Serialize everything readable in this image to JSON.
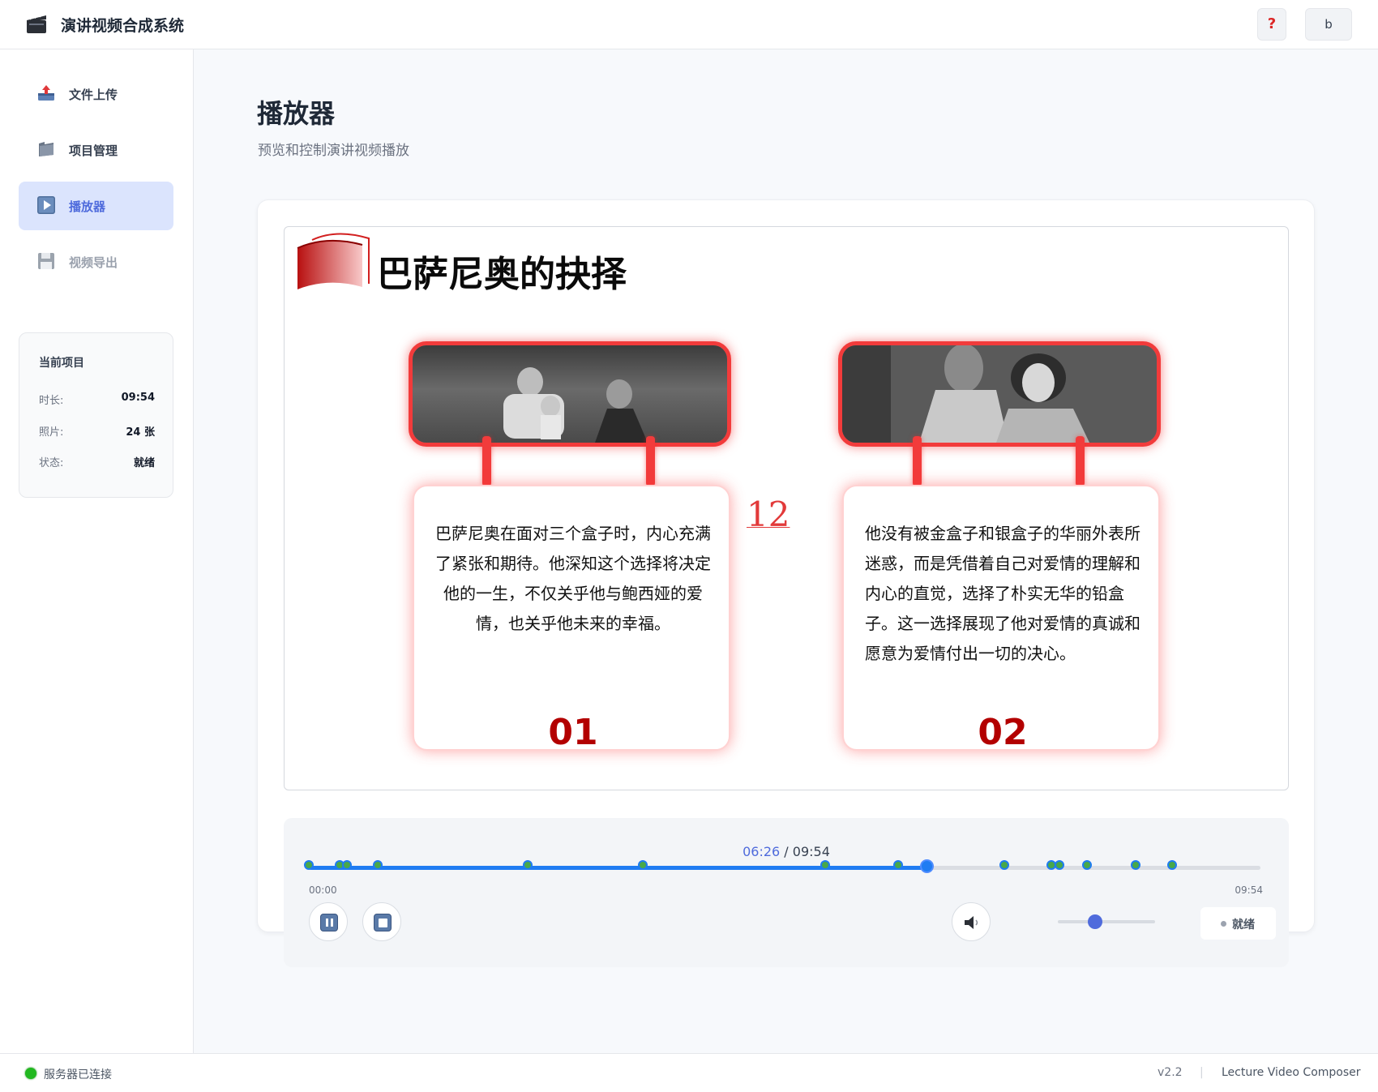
{
  "app": {
    "title": "演讲视频合成系统",
    "help_label": "?",
    "user_label": "b"
  },
  "sidebar": {
    "items": [
      {
        "label": "文件上传",
        "icon": "upload-tray-icon",
        "state": "normal"
      },
      {
        "label": "项目管理",
        "icon": "folder-icon",
        "state": "normal"
      },
      {
        "label": "播放器",
        "icon": "play-icon",
        "state": "active"
      },
      {
        "label": "视频导出",
        "icon": "floppy-disk-icon",
        "state": "disabled"
      }
    ],
    "project": {
      "title": "当前项目",
      "duration_label": "时长:",
      "duration_value": "09:54",
      "photos_label": "照片:",
      "photos_value": "24 张",
      "status_label": "状态:",
      "status_value": "就绪"
    }
  },
  "main": {
    "title": "播放器",
    "subtitle": "预览和控制演讲视频播放"
  },
  "slide": {
    "title": "巴萨尼奥的抉择",
    "page_number": "12",
    "cards": [
      {
        "text": "巴萨尼奥在面对三个盒子时，内心充满了紧张和期待。他深知这个选择将决定他的一生，不仅关乎他与鲍西娅的爱情，也关乎他未来的幸福。",
        "number": "01"
      },
      {
        "text": "他没有被金盒子和银盒子的华丽外表所迷惑，而是凭借着自己对爱情的理解和内心的直觉，选择了朴实无华的铅盒子。这一选择展现了他对爱情的真诚和愿意为爱情付出一切的决心。",
        "number": "02"
      }
    ]
  },
  "player": {
    "current_time": "06:26",
    "separator": "/",
    "total_time": "09:54",
    "start_tick": "00:00",
    "end_tick": "09:54",
    "progress_fraction": 0.649,
    "markers_fraction": [
      0.0,
      0.032,
      0.04,
      0.072,
      0.23,
      0.351,
      0.543,
      0.619,
      0.731,
      0.78,
      0.789,
      0.818,
      0.869,
      0.907
    ],
    "volume_fraction": 0.38,
    "status": "就绪",
    "colors": {
      "accent": "#1f7cf2",
      "marker": "#48a84a",
      "brand_red": "#f23b3b"
    }
  },
  "statusbar": {
    "connection": "服务器已连接",
    "version": "v2.2",
    "separator": "|",
    "product": "Lecture Video Composer"
  }
}
